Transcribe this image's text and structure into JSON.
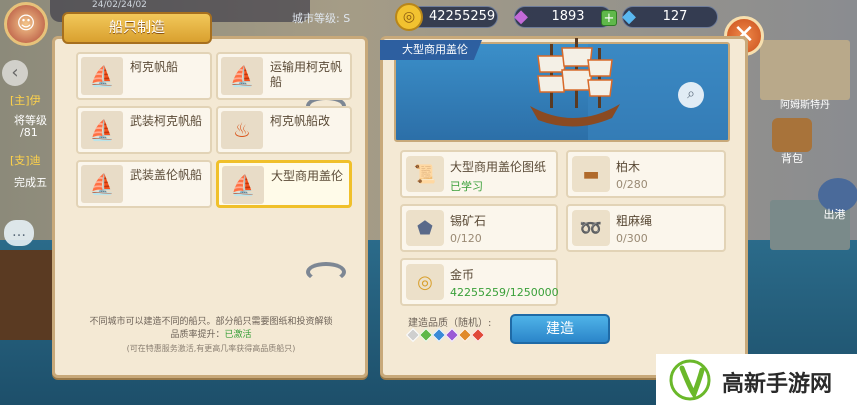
{
  "hud": {
    "date_text": "24/02/24/02",
    "city_level_label": "城市等级: S",
    "gold": "42255259",
    "diamond_purple": "1893",
    "diamond_blue": "127",
    "left_lines": [
      "[主]伊",
      "将等级",
      "/81",
      "[支]迪",
      "完成五"
    ],
    "right_labels": {
      "area": "阿姆斯特丹",
      "bag": "背包",
      "port": "出港"
    }
  },
  "panel": {
    "title": "船只制造",
    "ships": [
      {
        "name": "柯克帆船"
      },
      {
        "name": "运输用柯克帆船"
      },
      {
        "name": "武装柯克帆船"
      },
      {
        "name": "柯克帆船改"
      },
      {
        "name": "武装盖伦帆船"
      },
      {
        "name": "大型商用盖伦"
      }
    ],
    "note_line1": "不同城市可以建造不同的船只。部分船只需要图纸和投资解锁",
    "note_line2_prefix": "品质率提升：",
    "note_line2_status": "已激活",
    "note_sub": "(可在特惠服务激活,有更高几率获得高品质船只)"
  },
  "detail": {
    "ship_title": "大型商用盖伦",
    "materials": [
      {
        "name": "大型商用盖伦图纸",
        "value": "已学习",
        "icon": "blueprint-icon",
        "green": true
      },
      {
        "name": "柏木",
        "value": "0/280",
        "icon": "log-icon",
        "green": false
      },
      {
        "name": "锡矿石",
        "value": "0/120",
        "icon": "ore-icon",
        "green": false
      },
      {
        "name": "粗麻绳",
        "value": "0/300",
        "icon": "rope-icon",
        "green": false
      },
      {
        "name": "金币",
        "value": "42255259/1250000",
        "icon": "coin-icon",
        "green": true
      }
    ],
    "quality_label": "建造品质（随机）:",
    "quality_gem_colors": [
      "#cfcfcf",
      "#5fb84a",
      "#3a8ad6",
      "#9a5ad6",
      "#e08a2a",
      "#e04a3a"
    ],
    "build_label": "建造"
  },
  "watermark": {
    "text": "高新手游网"
  }
}
